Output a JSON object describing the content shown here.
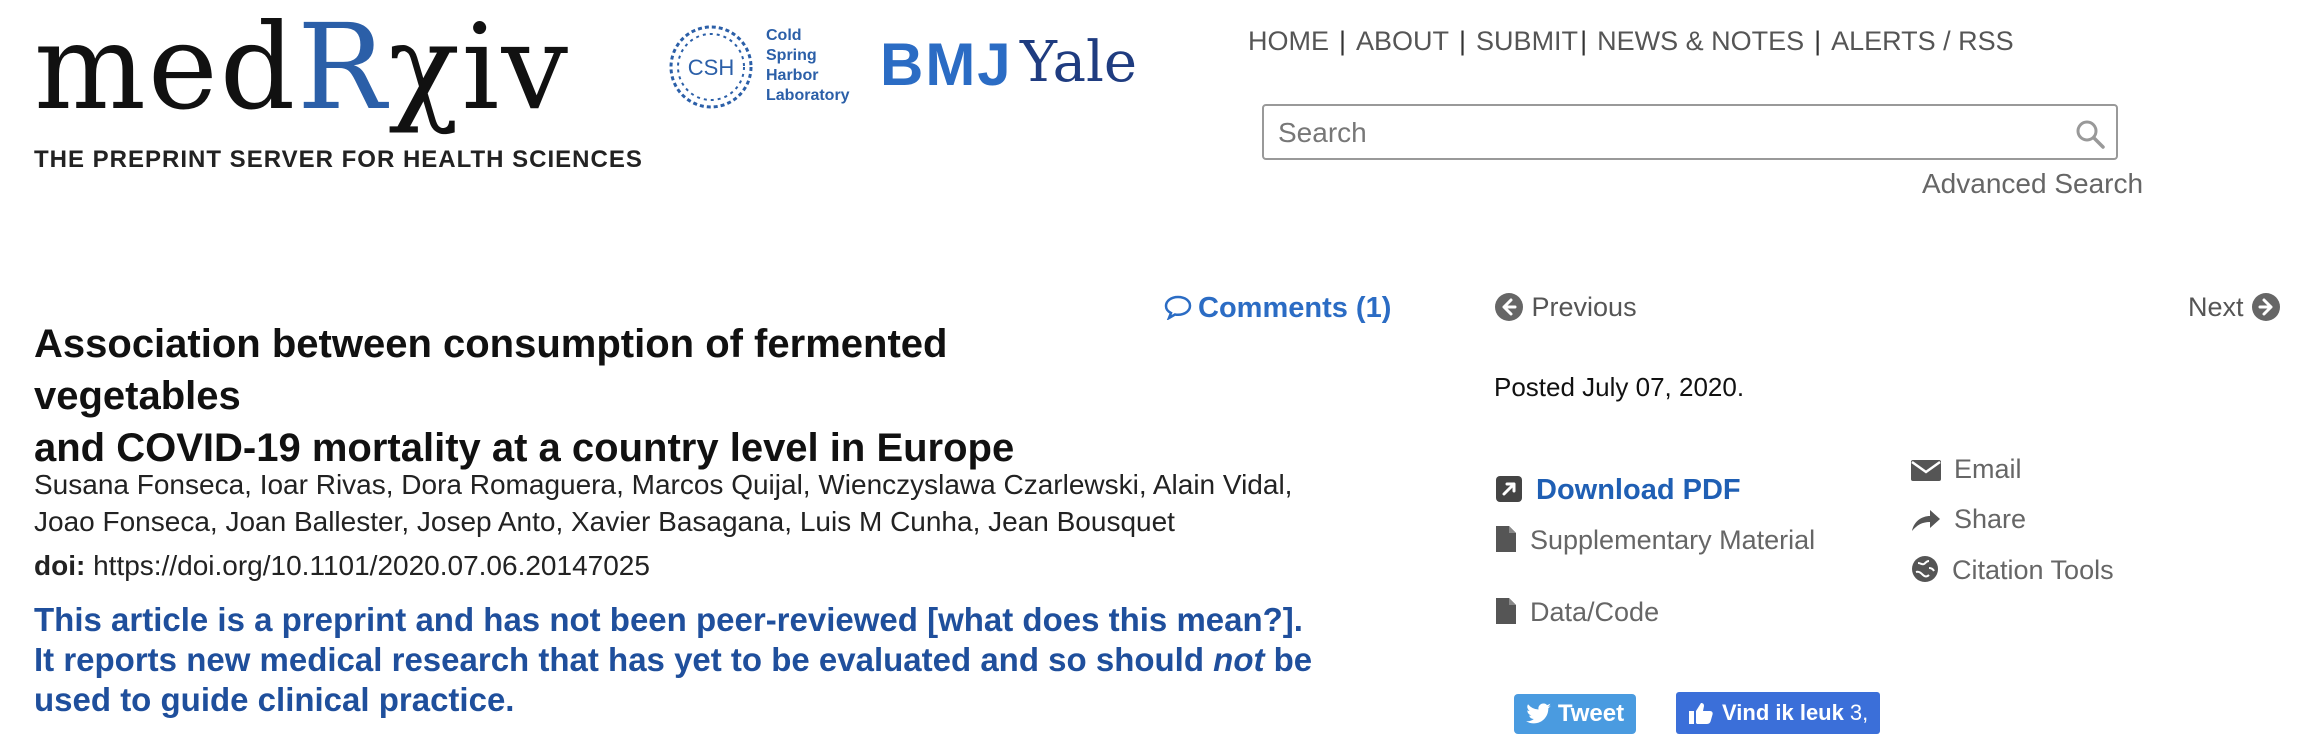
{
  "logo": {
    "word_pre": "med",
    "word_r": "R",
    "word_post": "χiv",
    "tagline": "THE PREPRINT SERVER FOR HEALTH SCIENCES"
  },
  "partners": {
    "csh_initials": "CSH",
    "csh_lines": [
      "Cold",
      "Spring",
      "Harbor",
      "Laboratory"
    ],
    "bmj": "BMJ",
    "yale": "Yale"
  },
  "nav": [
    "HOME",
    "ABOUT",
    "SUBMIT",
    "NEWS & NOTES",
    "ALERTS / RSS"
  ],
  "search": {
    "placeholder": "Search",
    "advanced": "Advanced Search"
  },
  "comments": "Comments (1)",
  "article": {
    "title_line1": "Association between consumption of fermented vegetables",
    "title_line2": "and COVID-19 mortality at a country level in Europe",
    "authors_line1": "Susana Fonseca, Ioar Rivas, Dora Romaguera, Marcos Quijal, Wienczyslawa Czarlewski, Alain Vidal,",
    "authors_line2": "Joao Fonseca, Joan Ballester, Josep Anto, Xavier Basagana, Luis M Cunha, Jean Bousquet",
    "doi_label": "doi:",
    "doi_value": "https://doi.org/10.1101/2020.07.06.20147025",
    "notice_line1": "This article is a preprint and has not been peer-reviewed [what does this mean?].",
    "notice_line2_a": "It reports new medical research that has yet to be evaluated and so should ",
    "notice_line2_em": "not",
    "notice_line2_b": " be",
    "notice_line3": "used to guide clinical practice."
  },
  "sidebar": {
    "previous": "Previous",
    "next": "Next",
    "posted": "Posted July 07, 2020.",
    "download_pdf": "Download PDF",
    "supplementary": "Supplementary Material",
    "data_code": "Data/Code",
    "email": "Email",
    "share": "Share",
    "citation_tools": "Citation Tools"
  },
  "social": {
    "tweet": "Tweet",
    "like": "Vind ik leuk",
    "like_count": "3,"
  },
  "colors": {
    "brand_blue": "#2b5fa8",
    "link_blue": "#1f5fb4",
    "notice_blue": "#1f4f9c",
    "tweet_blue": "#4a9be0",
    "facebook_blue": "#3b6fd9"
  }
}
